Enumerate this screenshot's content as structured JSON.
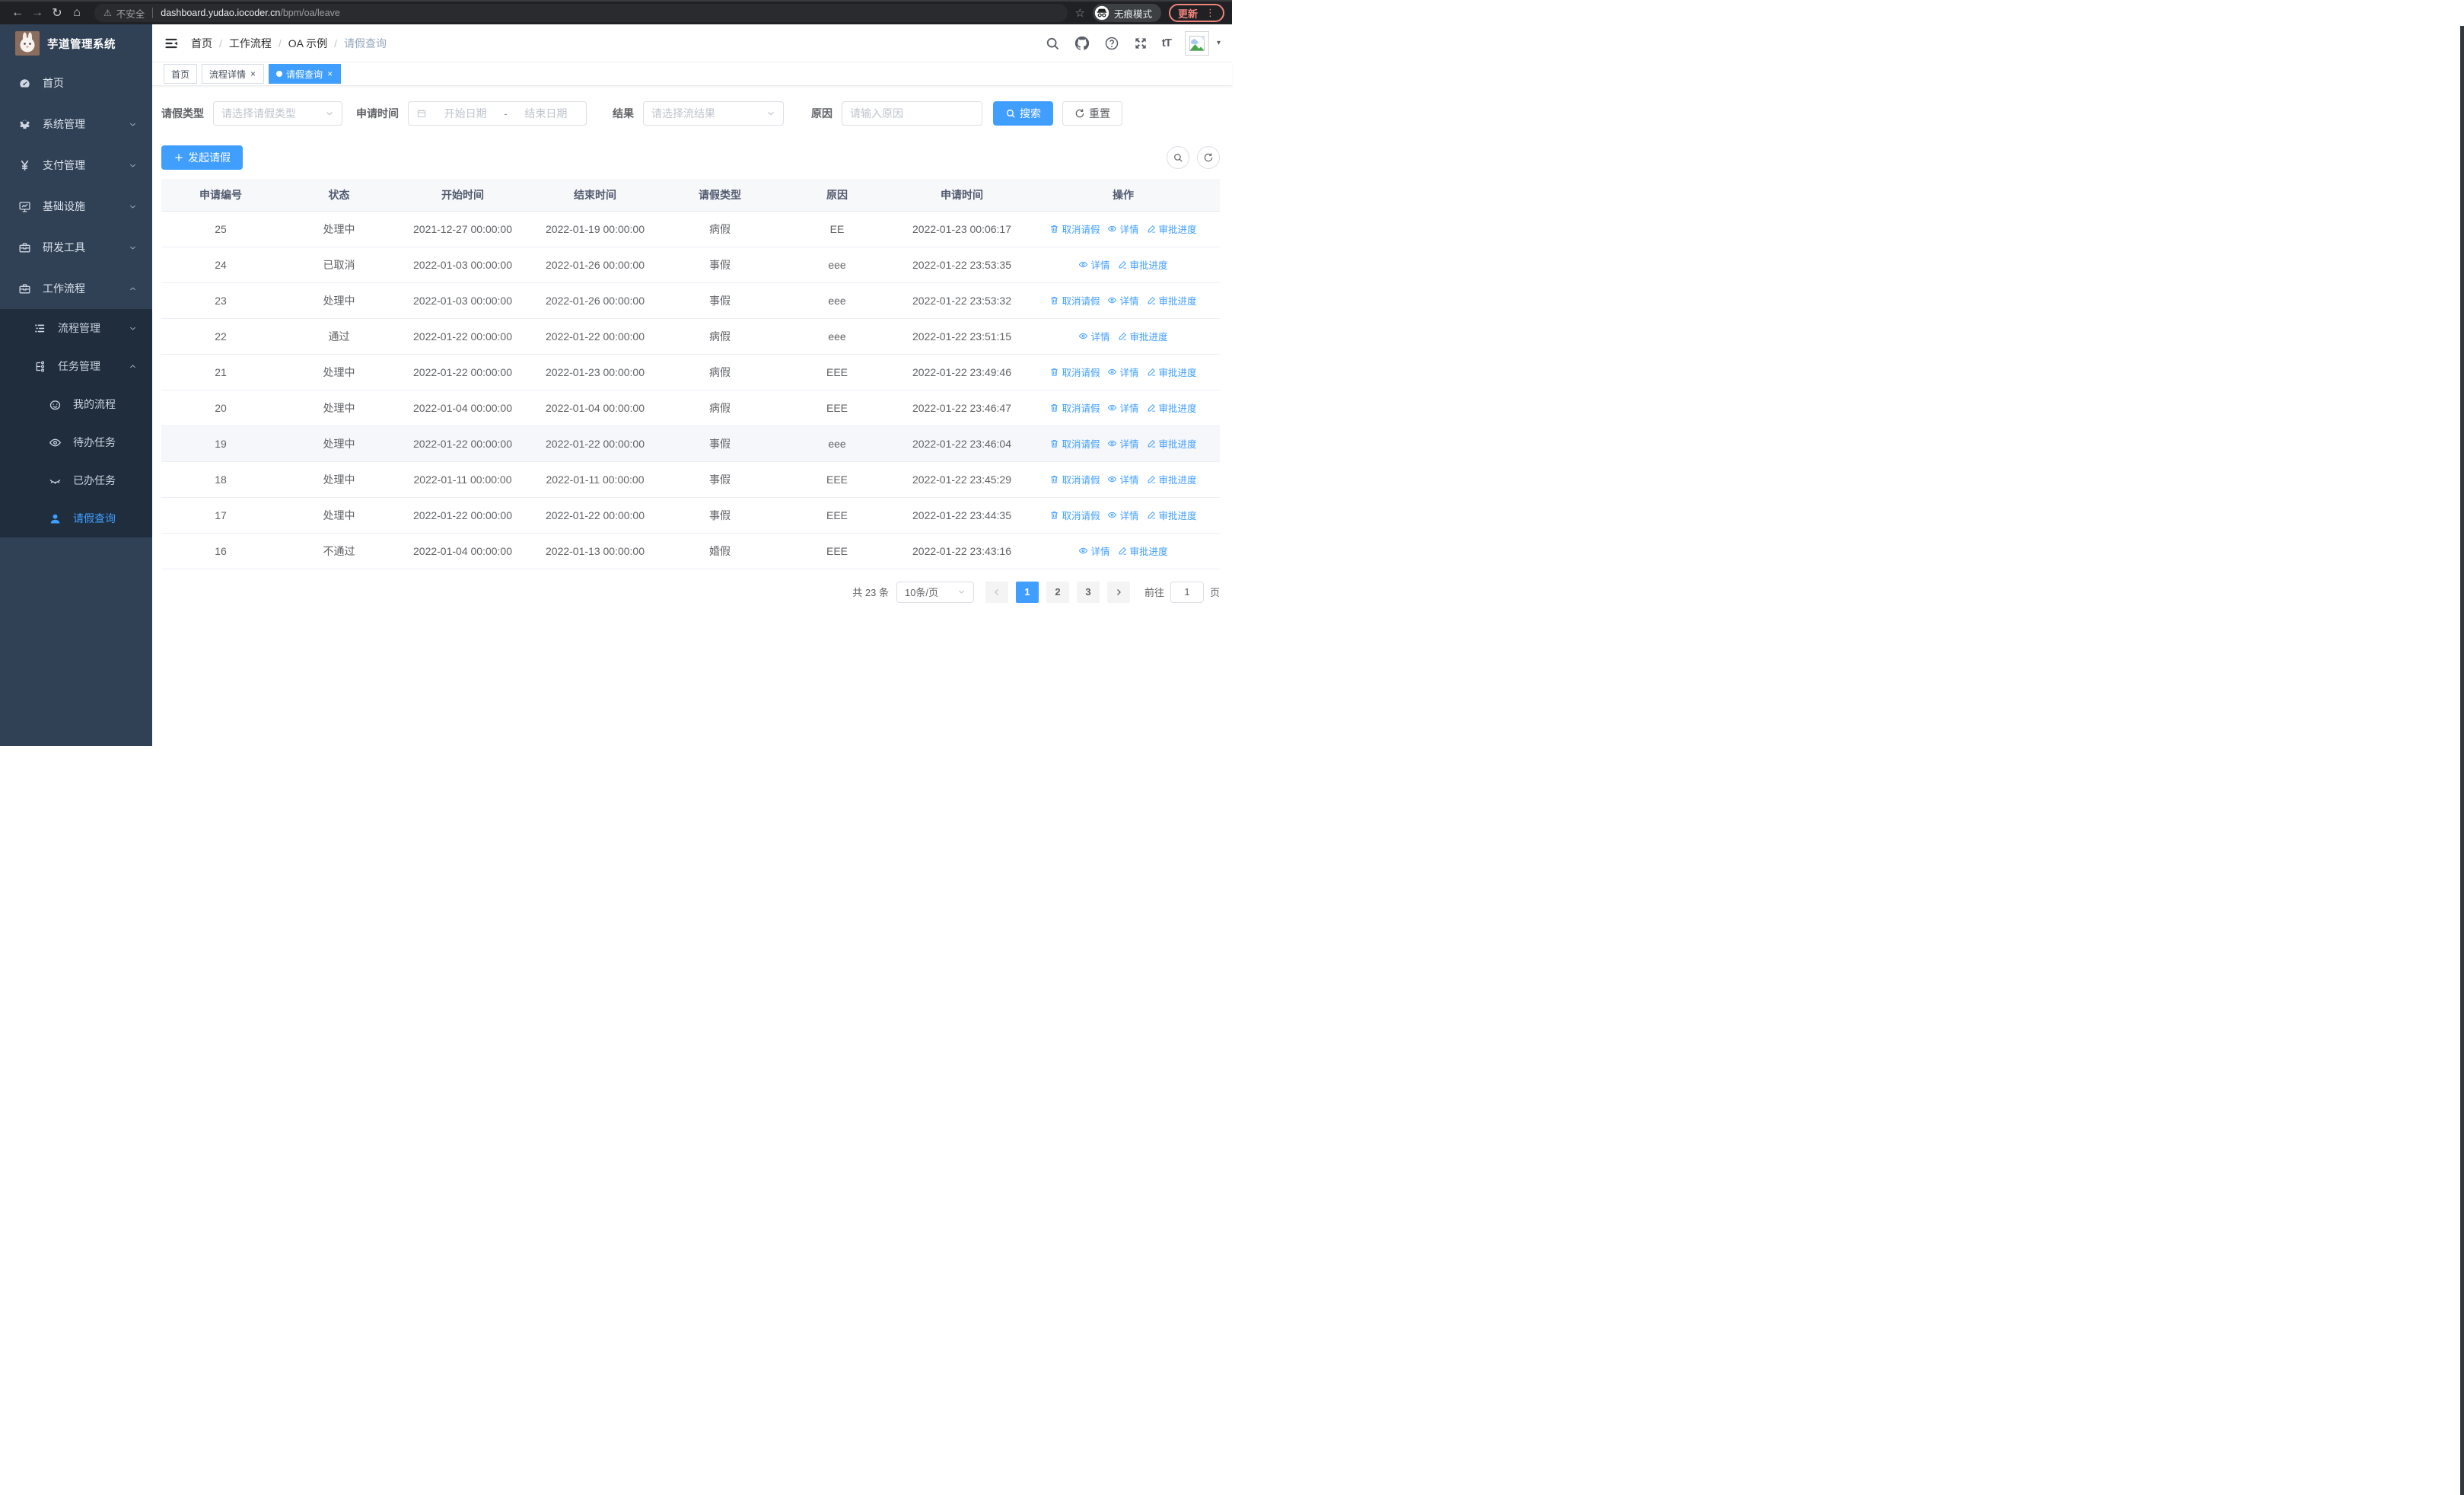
{
  "browser": {
    "security_label": "不安全",
    "url_host": "dashboard.yudao.iocoder.cn",
    "url_path": "/bpm/oa/leave",
    "incognito_label": "无痕模式",
    "update_label": "更新"
  },
  "sidebar": {
    "app_title": "芋道管理系统",
    "menu": [
      {
        "key": "home",
        "label": "首页",
        "icon": "dashboard-icon",
        "level": 1
      },
      {
        "key": "system-management",
        "label": "系统管理",
        "icon": "gear-icon",
        "level": 1,
        "chevron": "down"
      },
      {
        "key": "payment-management",
        "label": "支付管理",
        "icon": "yen-icon",
        "level": 1,
        "chevron": "down"
      },
      {
        "key": "infrastructure",
        "label": "基础设施",
        "icon": "monitor-icon",
        "level": 1,
        "chevron": "down"
      },
      {
        "key": "dev-tools",
        "label": "研发工具",
        "icon": "toolbox-icon",
        "level": 1,
        "chevron": "down"
      },
      {
        "key": "workflow",
        "label": "工作流程",
        "icon": "briefcase-icon",
        "level": 1,
        "chevron": "up"
      },
      {
        "key": "process-management",
        "label": "流程管理",
        "icon": "list-icon",
        "level": 2,
        "chevron": "down",
        "in_submenu": true
      },
      {
        "key": "task-management",
        "label": "任务管理",
        "icon": "tree-icon",
        "level": 2,
        "chevron": "up",
        "in_submenu": true
      },
      {
        "key": "my-process",
        "label": "我的流程",
        "icon": "face-icon",
        "level": 3,
        "in_submenu": true
      },
      {
        "key": "todo-tasks",
        "label": "待办任务",
        "icon": "eye-open-icon",
        "level": 3,
        "in_submenu": true
      },
      {
        "key": "done-tasks",
        "label": "已办任务",
        "icon": "eye-closed-icon",
        "level": 3,
        "in_submenu": true
      },
      {
        "key": "leave-query",
        "label": "请假查询",
        "icon": "user-icon",
        "level": 3,
        "in_submenu": true,
        "active": true
      }
    ]
  },
  "header": {
    "breadcrumb": [
      "首页",
      "工作流程",
      "OA 示例",
      "请假查询"
    ],
    "icons": [
      "search-icon",
      "github-icon",
      "help-icon",
      "fullscreen-icon",
      "font-size-icon",
      "avatar-image",
      "caret-down-icon"
    ]
  },
  "tabs": [
    {
      "key": "home",
      "label": "首页",
      "closable": false,
      "active": false
    },
    {
      "key": "process-detail",
      "label": "流程详情",
      "closable": true,
      "active": false
    },
    {
      "key": "leave-query",
      "label": "请假查询",
      "closable": true,
      "active": true
    }
  ],
  "filters": {
    "leave_type": {
      "label": "请假类型",
      "placeholder": "请选择请假类型"
    },
    "apply_time": {
      "label": "申请时间",
      "start_placeholder": "开始日期",
      "separator": "-",
      "end_placeholder": "结束日期"
    },
    "result": {
      "label": "结果",
      "placeholder": "请选择流结果"
    },
    "reason": {
      "label": "原因",
      "placeholder": "请输入原因"
    },
    "search_label": "搜索",
    "reset_label": "重置"
  },
  "toolbar": {
    "create_label": "发起请假"
  },
  "table": {
    "columns": [
      "申请编号",
      "状态",
      "开始时间",
      "结束时间",
      "请假类型",
      "原因",
      "申请时间",
      "操作"
    ],
    "action_labels": {
      "cancel": "取消请假",
      "detail": "详情",
      "progress": "审批进度"
    },
    "rows": [
      {
        "id": "25",
        "status": "处理中",
        "start": "2021-12-27 00:00:00",
        "end": "2022-01-19 00:00:00",
        "type": "病假",
        "reason": "EE",
        "apply_time": "2022-01-23 00:06:17",
        "actions": [
          "cancel",
          "detail",
          "progress"
        ]
      },
      {
        "id": "24",
        "status": "已取消",
        "start": "2022-01-03 00:00:00",
        "end": "2022-01-26 00:00:00",
        "type": "事假",
        "reason": "eee",
        "apply_time": "2022-01-22 23:53:35",
        "actions": [
          "detail",
          "progress"
        ]
      },
      {
        "id": "23",
        "status": "处理中",
        "start": "2022-01-03 00:00:00",
        "end": "2022-01-26 00:00:00",
        "type": "事假",
        "reason": "eee",
        "apply_time": "2022-01-22 23:53:32",
        "actions": [
          "cancel",
          "detail",
          "progress"
        ]
      },
      {
        "id": "22",
        "status": "通过",
        "start": "2022-01-22 00:00:00",
        "end": "2022-01-22 00:00:00",
        "type": "病假",
        "reason": "eee",
        "apply_time": "2022-01-22 23:51:15",
        "actions": [
          "detail",
          "progress"
        ]
      },
      {
        "id": "21",
        "status": "处理中",
        "start": "2022-01-22 00:00:00",
        "end": "2022-01-23 00:00:00",
        "type": "病假",
        "reason": "EEE",
        "apply_time": "2022-01-22 23:49:46",
        "actions": [
          "cancel",
          "detail",
          "progress"
        ]
      },
      {
        "id": "20",
        "status": "处理中",
        "start": "2022-01-04 00:00:00",
        "end": "2022-01-04 00:00:00",
        "type": "病假",
        "reason": "EEE",
        "apply_time": "2022-01-22 23:46:47",
        "actions": [
          "cancel",
          "detail",
          "progress"
        ]
      },
      {
        "id": "19",
        "status": "处理中",
        "start": "2022-01-22 00:00:00",
        "end": "2022-01-22 00:00:00",
        "type": "事假",
        "reason": "eee",
        "apply_time": "2022-01-22 23:46:04",
        "actions": [
          "cancel",
          "detail",
          "progress"
        ],
        "highlighted": true
      },
      {
        "id": "18",
        "status": "处理中",
        "start": "2022-01-11 00:00:00",
        "end": "2022-01-11 00:00:00",
        "type": "事假",
        "reason": "EEE",
        "apply_time": "2022-01-22 23:45:29",
        "actions": [
          "cancel",
          "detail",
          "progress"
        ]
      },
      {
        "id": "17",
        "status": "处理中",
        "start": "2022-01-22 00:00:00",
        "end": "2022-01-22 00:00:00",
        "type": "事假",
        "reason": "EEE",
        "apply_time": "2022-01-22 23:44:35",
        "actions": [
          "cancel",
          "detail",
          "progress"
        ]
      },
      {
        "id": "16",
        "status": "不通过",
        "start": "2022-01-04 00:00:00",
        "end": "2022-01-13 00:00:00",
        "type": "婚假",
        "reason": "EEE",
        "apply_time": "2022-01-22 23:43:16",
        "actions": [
          "detail",
          "progress"
        ]
      }
    ]
  },
  "pagination": {
    "total_label": "共 23 条",
    "page_size": "10条/页",
    "pages": [
      "1",
      "2",
      "3"
    ],
    "active_page": "1",
    "goto_label": "前往",
    "goto_value": "1",
    "goto_unit": "页"
  },
  "colors": {
    "primary": "#409eff",
    "sidebar_bg": "#304156",
    "submenu_bg": "#1f2d3d",
    "browser_bar": "#202124",
    "update_accent": "#ee837a",
    "table_header_bg": "#f7f8fa",
    "row_highlight": "#f5f7fa"
  }
}
